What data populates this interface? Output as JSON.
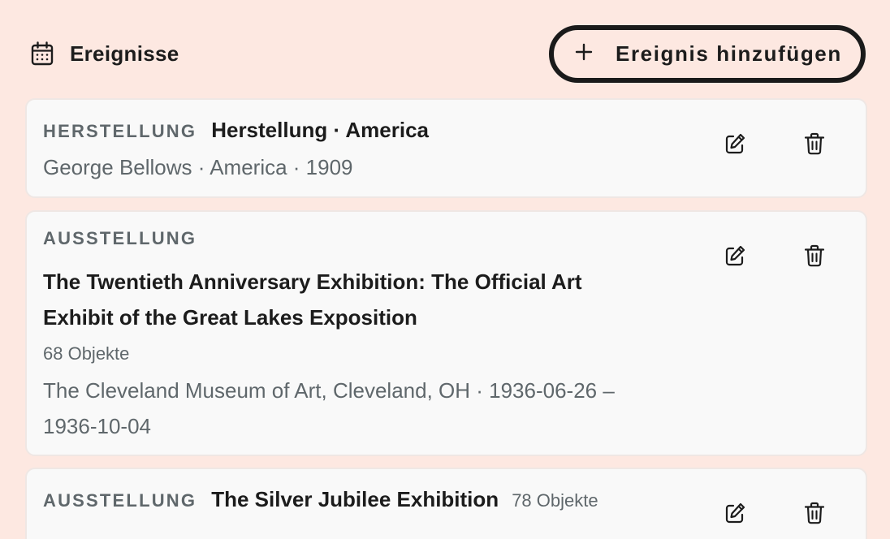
{
  "header": {
    "icon": "calendar-icon",
    "title": "Ereignisse",
    "add_button_label": "Ereignis hinzufügen",
    "add_icon": "plus-icon"
  },
  "events": [
    {
      "kind": "HERSTELLUNG",
      "title": "Herstellung · America",
      "meta": "George Bellows · America · 1909"
    },
    {
      "kind": "AUSSTELLUNG",
      "title_line1": "The Twentieth Anniversary Exhibition: The Official Art",
      "title_line2": "Exhibit of the Great Lakes Exposition",
      "count": "68 Objekte",
      "meta_line1": "The Cleveland Museum of Art, Cleveland, OH · 1936-06-26 –",
      "meta_line2": "1936-10-04"
    },
    {
      "kind": "AUSSTELLUNG",
      "title": "The Silver Jubilee Exhibition",
      "count": "78 Objekte"
    }
  ],
  "actions": {
    "edit_icon": "edit-icon",
    "delete_icon": "trash-icon"
  },
  "colors": {
    "background": "#fde8e1",
    "card": "#f9f9f9",
    "muted_text": "#5f676b",
    "text": "#1c1c1c"
  }
}
